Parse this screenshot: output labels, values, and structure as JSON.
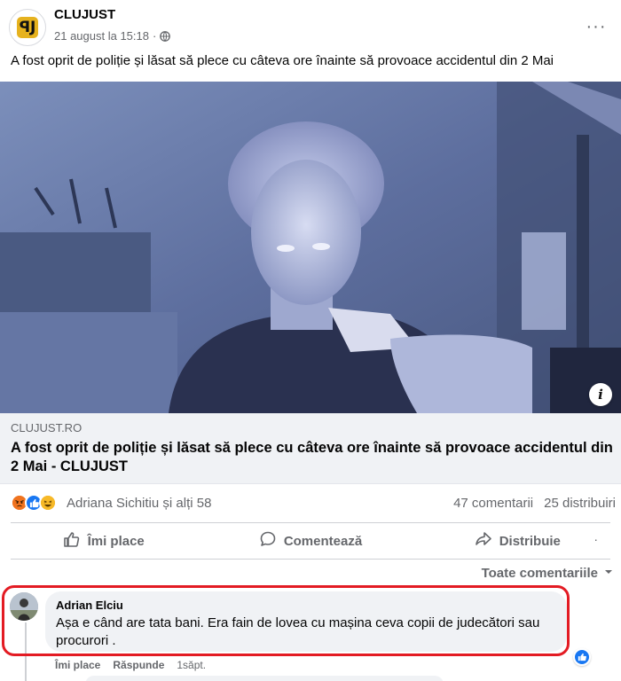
{
  "post": {
    "page_name": "CLUJUST",
    "logo_letter": "ꟼJ",
    "timestamp": "21 august la 15:18",
    "meta_separator": "·",
    "text": "A fost oprit de poliție și lăsat să plece cu câteva ore înainte să provoace accidentul din 2 Mai",
    "more_label": "···"
  },
  "link_preview": {
    "domain": "CLUJUST.RO",
    "title": "A fost oprit de poliție și lăsat să plece cu câteva ore înainte să provoace accidentul din 2 Mai - CLUJUST",
    "info_label": "i"
  },
  "reactions": {
    "types": [
      "angry",
      "like",
      "haha"
    ],
    "names": "Adriana Sichitiu și alți 58",
    "comments_count": "47 comentarii",
    "shares_count": "25 distribuiri"
  },
  "actions": {
    "like": "Îmi place",
    "comment": "Comentează",
    "share": "Distribuie",
    "extra": "·"
  },
  "comments_filter": {
    "label": "Toate comentariile"
  },
  "comment": {
    "author": "Adrian Elciu",
    "text": "Așa e când are tata bani. Era fain de lovea cu mașina ceva copii de judecători sau procurori .",
    "like_action": "Îmi place",
    "reply_action": "Răspunde",
    "time": "1săpt."
  },
  "colors": {
    "accent_blue": "#1877f2",
    "highlight_red": "#e31b23",
    "muted_text": "#65676b",
    "logo_yellow": "#e6b21e"
  },
  "icons": [
    "globe-icon",
    "more-icon",
    "info-icon",
    "like-icon",
    "comment-icon",
    "share-icon",
    "chevron-down-icon"
  ]
}
